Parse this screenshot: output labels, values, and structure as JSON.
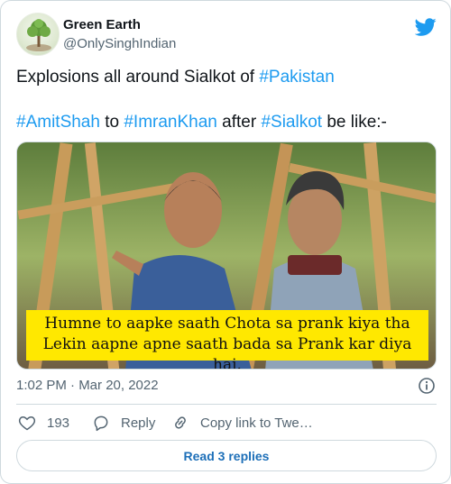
{
  "author": {
    "name": "Green Earth",
    "handle": "@OnlySinghIndian"
  },
  "tweet": {
    "line1_text": "Explosions all around Sialkot of ",
    "line1_tag": "#Pakistan",
    "line2_tag1": "#AmitShah",
    "line2_text1": " to ",
    "line2_tag2": "#ImranKhan",
    "line2_text2": " after ",
    "line2_tag3": "#Sialkot",
    "line2_text3": " be like:-"
  },
  "media": {
    "caption_line1": "Humne to aapke saath Chota sa prank kiya tha",
    "caption_line2": "Lekin aapne apne saath bada sa Prank kar diya hai."
  },
  "meta": {
    "timestamp": "1:02 PM · Mar 20, 2022"
  },
  "actions": {
    "like_count": "193",
    "reply_label": "Reply",
    "copy_link_label": "Copy link to Twe…"
  },
  "replies_button": {
    "label": "Read 3 replies"
  },
  "colors": {
    "link_blue": "#1d9bf0",
    "text_primary": "#0f1419",
    "text_secondary": "#536471",
    "border": "#cfd9de",
    "caption_bg": "#ffe800"
  }
}
